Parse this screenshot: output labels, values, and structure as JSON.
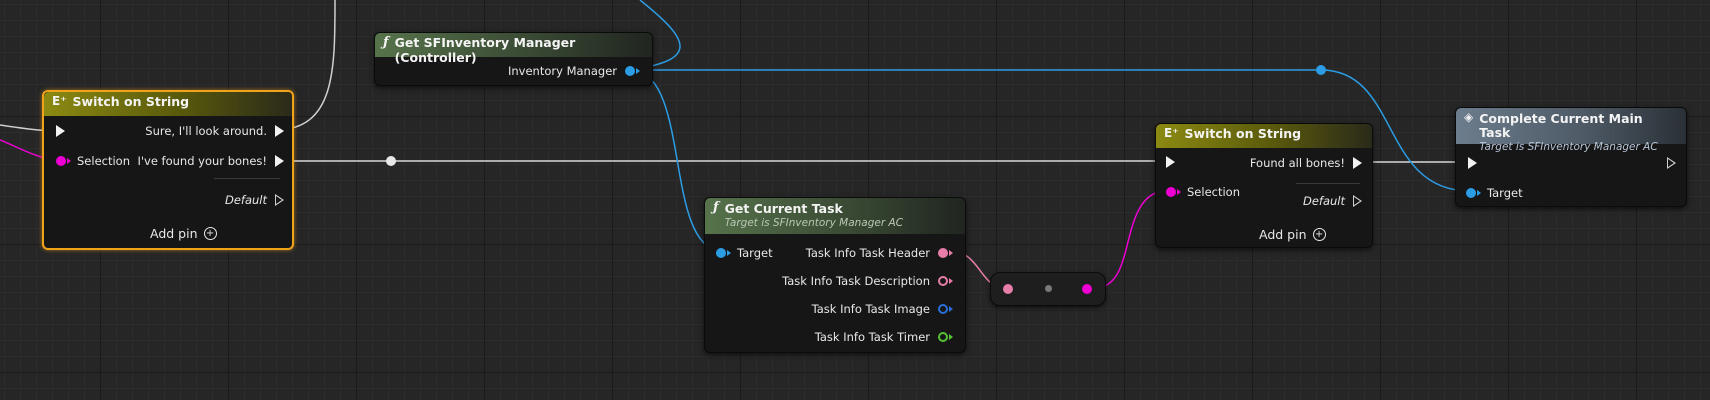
{
  "colors": {
    "exec": "#f2f2f2",
    "string_pin": "#ee00d5",
    "object_pin": "#2c9ce4",
    "text_pin": "#e67ea8",
    "image_pin": "#2a6fd8",
    "timer_pin": "#55c136",
    "selection_outline": "#f0a21b"
  },
  "nodes": {
    "switch1": {
      "icon": "switch-icon",
      "title": "Switch on String",
      "selection_label": "Selection",
      "outputs": [
        "Sure, I'll look around.",
        "I've found your bones!"
      ],
      "default_label": "Default",
      "add_pin_label": "Add pin"
    },
    "get_inventory": {
      "icon": "function-icon",
      "title": "Get SFInventory Manager (Controller)",
      "output_label": "Inventory Manager"
    },
    "get_task": {
      "icon": "function-icon",
      "title": "Get Current Task",
      "subtitle": "Target is SFInventory Manager AC",
      "target_label": "Target",
      "outputs": [
        "Task Info Task Header",
        "Task Info Task Description",
        "Task Info Task Image",
        "Task Info Task Timer"
      ]
    },
    "switch2": {
      "icon": "switch-icon",
      "title": "Switch on String",
      "selection_label": "Selection",
      "output": "Found all bones!",
      "default_label": "Default",
      "add_pin_label": "Add pin"
    },
    "complete_task": {
      "icon": "function-icon",
      "title": "Complete Current Main Task",
      "subtitle": "Target is SFInventory Manager AC",
      "target_label": "Target"
    }
  },
  "glyphs": {
    "func": "ƒ",
    "switch": "E⁺",
    "plus": "+"
  }
}
